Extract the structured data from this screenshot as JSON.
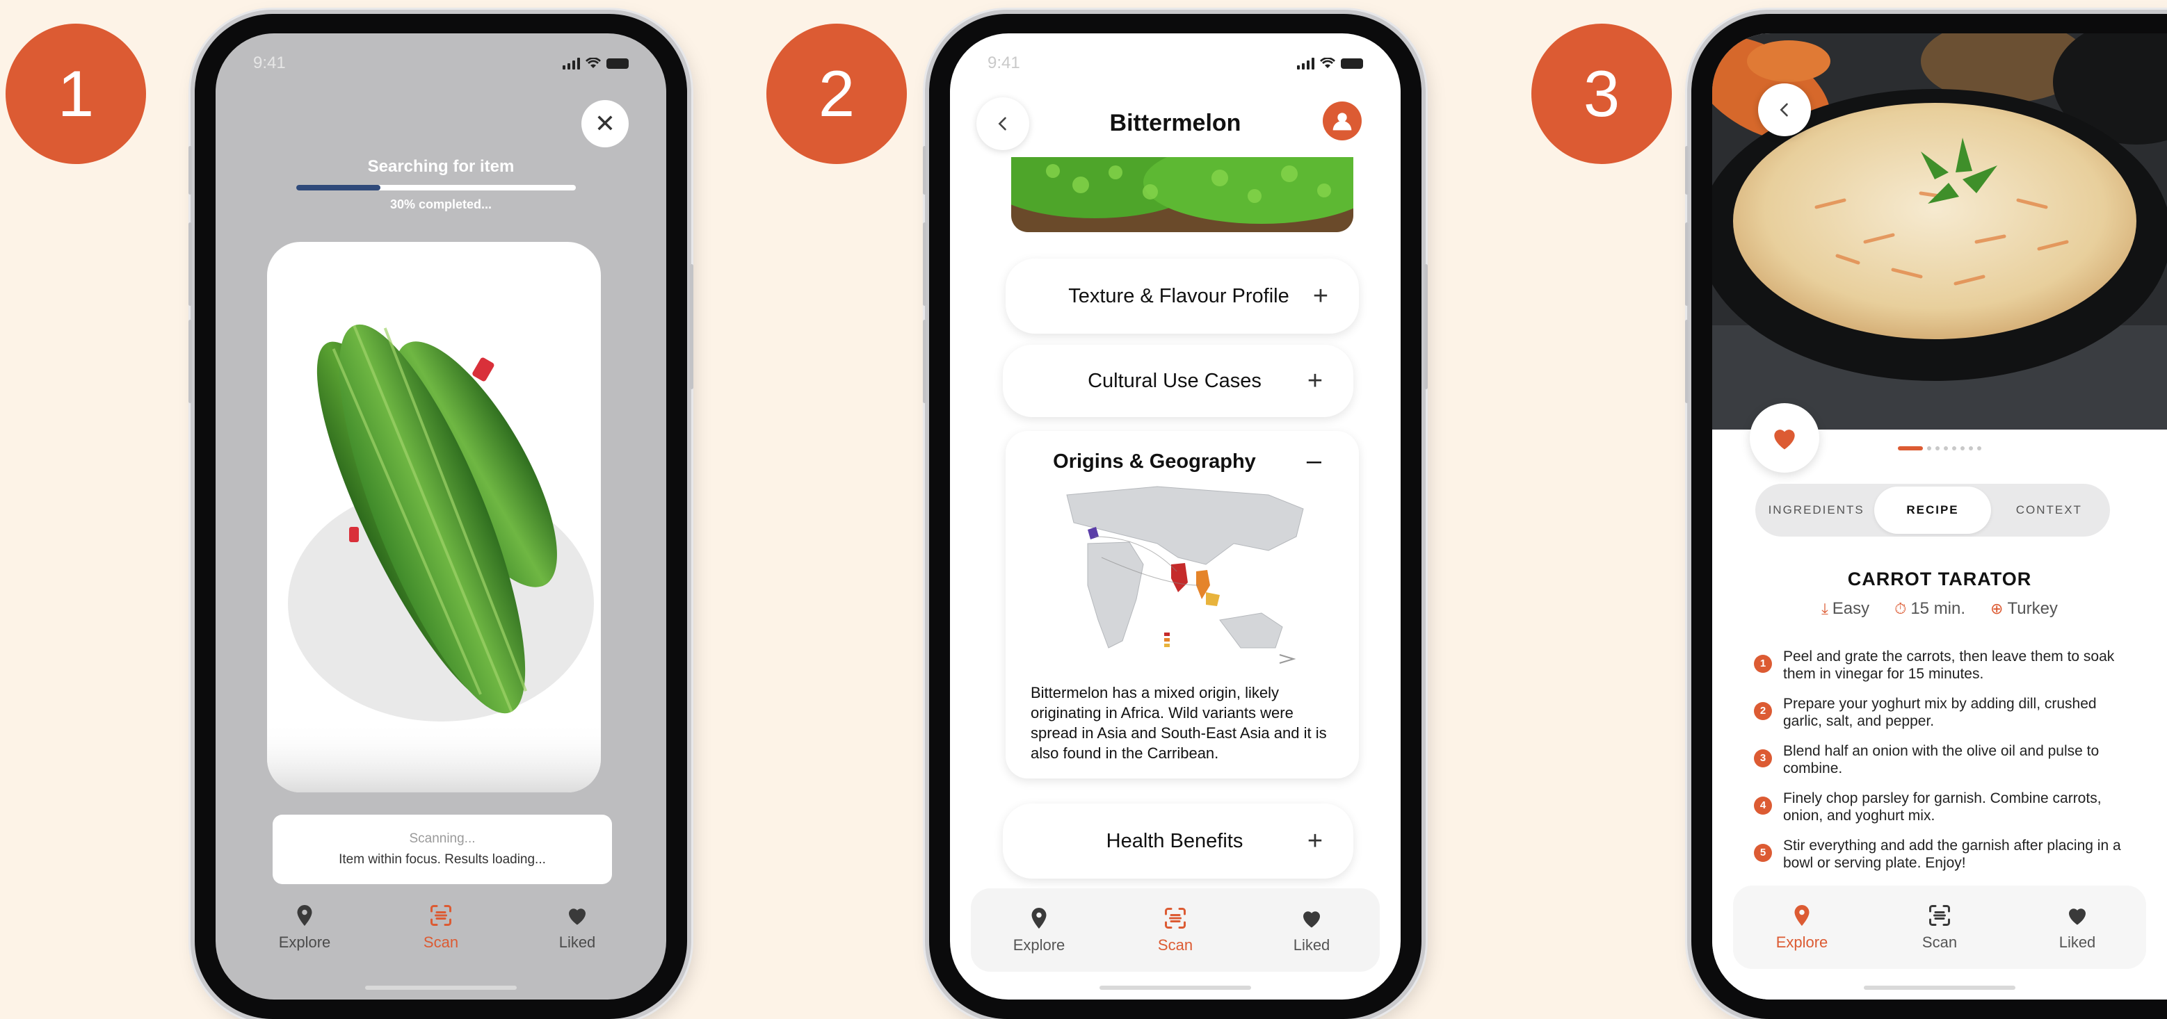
{
  "steps": [
    "1",
    "2",
    "3"
  ],
  "colors": {
    "accent": "#dc5b33",
    "background": "#fdf3e7",
    "progress": "#2f4a7a"
  },
  "status_bar": {
    "time": "9:41"
  },
  "nav": {
    "explore": "Explore",
    "scan": "Scan",
    "liked": "Liked"
  },
  "scan_screen": {
    "title": "Searching for item",
    "progress_percent": 30,
    "progress_text": "30% completed...",
    "status_line1": "Scanning...",
    "status_line2": "Item within focus. Results loading...",
    "close_icon": "close-icon",
    "active_tab": "scan"
  },
  "detail_screen": {
    "title": "Bittermelon",
    "sections": [
      {
        "label": "Texture & Flavour Profile",
        "expanded": false
      },
      {
        "label": "Cultural Use Cases",
        "expanded": false
      },
      {
        "label": "Origins & Geography",
        "expanded": true
      },
      {
        "label": "Health Benefits",
        "expanded": false
      }
    ],
    "origins_text": "Bittermelon has a mixed origin, likely originating in Africa. Wild variants were spread in Asia and South-East Asia and it is also found in the Carribean.",
    "active_tab": "scan"
  },
  "recipe_screen": {
    "tabs": [
      "INGREDIENTS",
      "RECIPE",
      "CONTEXT"
    ],
    "active_tab_index": 1,
    "recipe_title": "CARROT TARATOR",
    "difficulty": "Easy",
    "time": "15 min.",
    "origin": "Turkey",
    "carousel_total": 8,
    "carousel_index": 0,
    "steps": [
      {
        "n": "1",
        "text": "Peel and grate the carrots, then leave them to soak them in vinegar for 15 minutes."
      },
      {
        "n": "2",
        "text": "Prepare your yoghurt mix by adding dill, crushed garlic, salt, and pepper."
      },
      {
        "n": "3",
        "text": "Blend half an onion with the olive oil and pulse to combine."
      },
      {
        "n": "4",
        "text": "Finely chop parsley for garnish. Combine carrots, onion, and yoghurt mix."
      },
      {
        "n": "5",
        "text": "Stir everything and add the garnish after placing in a bowl or serving plate. Enjoy!"
      }
    ],
    "active_tab": "explore"
  }
}
